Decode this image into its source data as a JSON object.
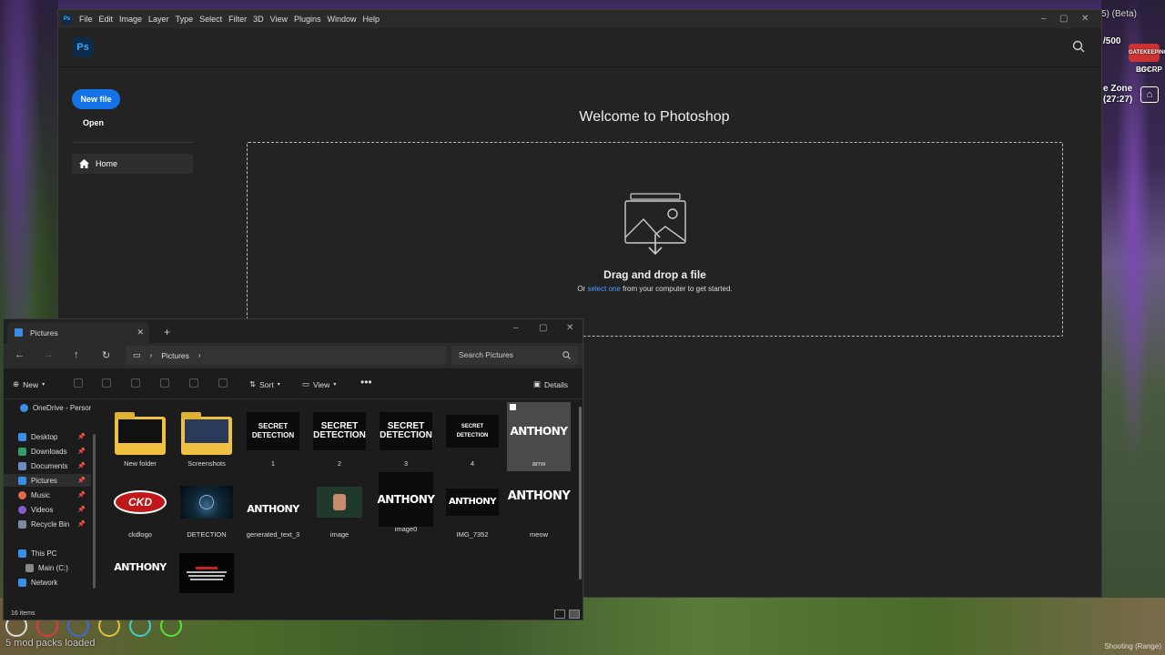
{
  "background": {
    "hud_beta": "5) (Beta)",
    "hud_count": "/500",
    "hud_logo": "GATEKEEPING CITY",
    "hud_bgcrp": "BGCRP",
    "hud_zone": "e Zone",
    "hud_time": "(27:27)",
    "mods_loaded": "5 mod packs loaded",
    "shooting": "Shooting (Range)"
  },
  "photoshop": {
    "menu": [
      "File",
      "Edit",
      "Image",
      "Layer",
      "Type",
      "Select",
      "Filter",
      "3D",
      "View",
      "Plugins",
      "Window",
      "Help"
    ],
    "logo": "Ps",
    "new_file": "New file",
    "open": "Open",
    "home": "Home",
    "welcome": "Welcome to Photoshop",
    "drop_title": "Drag and drop a file",
    "drop_sub_pre": "Or",
    "drop_sub_link": "select one",
    "drop_sub_post": "from your computer to get started."
  },
  "explorer": {
    "tab_title": "Pictures",
    "breadcrumb": "Pictures",
    "search_placeholder": "Search Pictures",
    "toolbar": {
      "new": "New",
      "sort": "Sort",
      "view": "View",
      "details": "Details"
    },
    "nav": {
      "onedrive": "OneDrive - Persor",
      "quick": [
        {
          "label": "Desktop",
          "color": "#3a8ee6"
        },
        {
          "label": "Downloads",
          "color": "#2f9e6a"
        },
        {
          "label": "Documents",
          "color": "#6b8cc8"
        },
        {
          "label": "Pictures",
          "color": "#3a8ee6"
        },
        {
          "label": "Music",
          "color": "#e06a4a"
        },
        {
          "label": "Videos",
          "color": "#8a5ad0"
        },
        {
          "label": "Recycle Bin",
          "color": "#7a8a9a"
        }
      ],
      "this_pc": "This PC",
      "main_c": "Main (C:)",
      "network": "Network"
    },
    "items": [
      {
        "label": "New folder"
      },
      {
        "label": "Screenshots"
      },
      {
        "label": "1",
        "thumb_text": "SECRET DETECTION"
      },
      {
        "label": "2",
        "thumb_text": "SECRET DETECTION"
      },
      {
        "label": "3",
        "thumb_text": "SECRET DETECTION"
      },
      {
        "label": "4",
        "thumb_text": "SECRET DETECTION"
      },
      {
        "label": "arrw",
        "thumb_text": "ANTHONY"
      },
      {
        "label": "ckdlogo",
        "thumb_text": "CKD"
      },
      {
        "label": "DETECTION"
      },
      {
        "label": "generated_text_3",
        "thumb_text": "ANTHONY"
      },
      {
        "label": "image"
      },
      {
        "label": "image0",
        "thumb_text": "ANTHONY"
      },
      {
        "label": "IMG_7352",
        "thumb_text": "ANTHONY"
      },
      {
        "label": "meow",
        "thumb_text": "ANTHONY"
      },
      {
        "label": "",
        "thumb_text": "ANTHONY"
      },
      {
        "label": ""
      }
    ],
    "status": "16 items"
  }
}
